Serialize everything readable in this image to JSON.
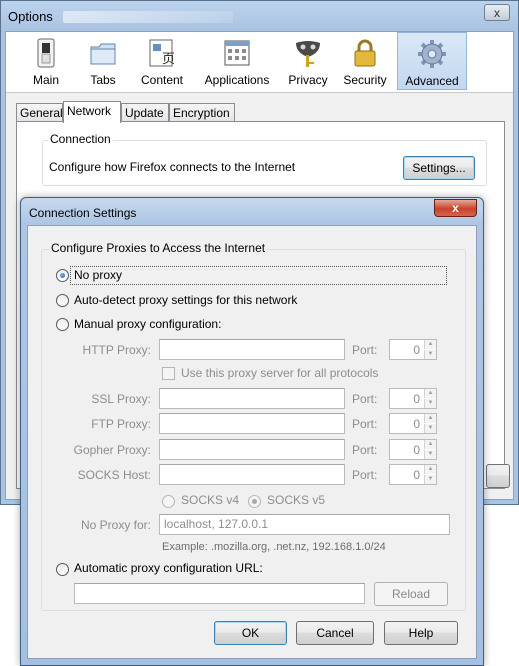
{
  "options_window": {
    "title": "Options",
    "close_label": "x",
    "toolbar": [
      {
        "id": "main",
        "label": "Main",
        "icon": "switch-icon"
      },
      {
        "id": "tabs",
        "label": "Tabs",
        "icon": "folder-tabs-icon"
      },
      {
        "id": "content",
        "label": "Content",
        "icon": "content-page-icon"
      },
      {
        "id": "applications",
        "label": "Applications",
        "icon": "applications-window-icon"
      },
      {
        "id": "privacy",
        "label": "Privacy",
        "icon": "mask-key-icon"
      },
      {
        "id": "security",
        "label": "Security",
        "icon": "padlock-icon"
      },
      {
        "id": "advanced",
        "label": "Advanced",
        "icon": "gear-icon",
        "active": true
      }
    ],
    "subtabs": [
      "General",
      "Network",
      "Update",
      "Encryption"
    ],
    "active_subtab": "Network",
    "connection": {
      "legend": "Connection",
      "description": "Configure how Firefox connects to the Internet",
      "settings_button": "Settings..."
    }
  },
  "connection_settings": {
    "title": "Connection Settings",
    "close_label": "x",
    "group_legend": "Configure Proxies to Access the Internet",
    "options": {
      "no_proxy": {
        "label": "No proxy",
        "checked": true
      },
      "auto_detect": {
        "label": "Auto-detect proxy settings for this network",
        "checked": false
      },
      "manual": {
        "label": "Manual proxy configuration:",
        "checked": false
      },
      "auto_url": {
        "label": "Automatic proxy configuration URL:",
        "checked": false
      }
    },
    "manual": {
      "http_label": "HTTP Proxy:",
      "ssl_label": "SSL Proxy:",
      "ftp_label": "FTP Proxy:",
      "gopher_label": "Gopher Proxy:",
      "socks_label": "SOCKS Host:",
      "port_label": "Port:",
      "ports": {
        "http": "0",
        "ssl": "0",
        "ftp": "0",
        "gopher": "0",
        "socks": "0"
      },
      "use_same_label": "Use this proxy server for all protocols",
      "socks_v4_label": "SOCKS v4",
      "socks_v5_label": "SOCKS v5",
      "socks_version_selected": "v5"
    },
    "no_proxy_for_label": "No Proxy for:",
    "no_proxy_for_value": "localhost, 127.0.0.1",
    "example_text": "Example: .mozilla.org, .net.nz, 192.168.1.0/24",
    "reload_button": "Reload",
    "ok_button": "OK",
    "cancel_button": "Cancel",
    "help_button": "Help"
  }
}
